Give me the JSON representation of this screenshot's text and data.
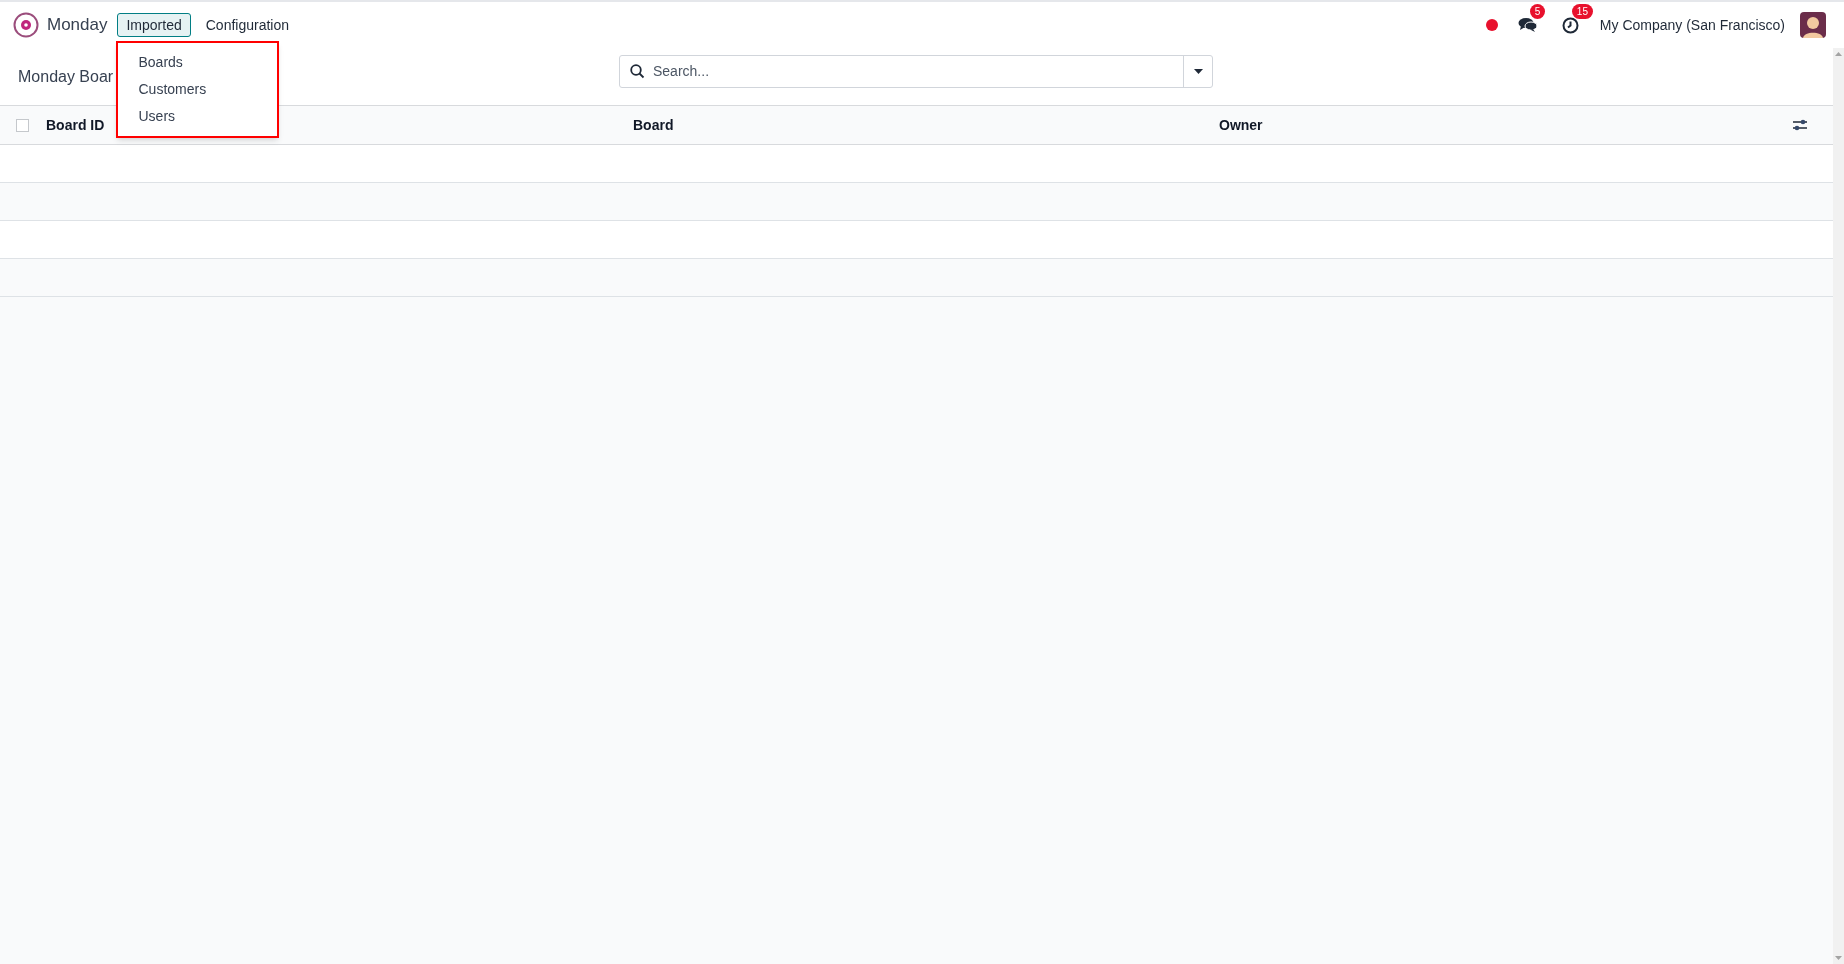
{
  "app": {
    "name": "Monday"
  },
  "menu": [
    {
      "label": "Imported",
      "selected": true,
      "items": [
        "Boards",
        "Customers",
        "Users"
      ]
    },
    {
      "label": "Configuration",
      "selected": false
    }
  ],
  "systray": {
    "recording": true,
    "messages_count": "5",
    "activities_count": "15",
    "company": "My Company (San Francisco)"
  },
  "breadcrumb": "Monday Boar",
  "search": {
    "placeholder": "Search..."
  },
  "table": {
    "select_all_checked": false,
    "columns": [
      "Board ID",
      "Board",
      "Owner"
    ]
  }
}
